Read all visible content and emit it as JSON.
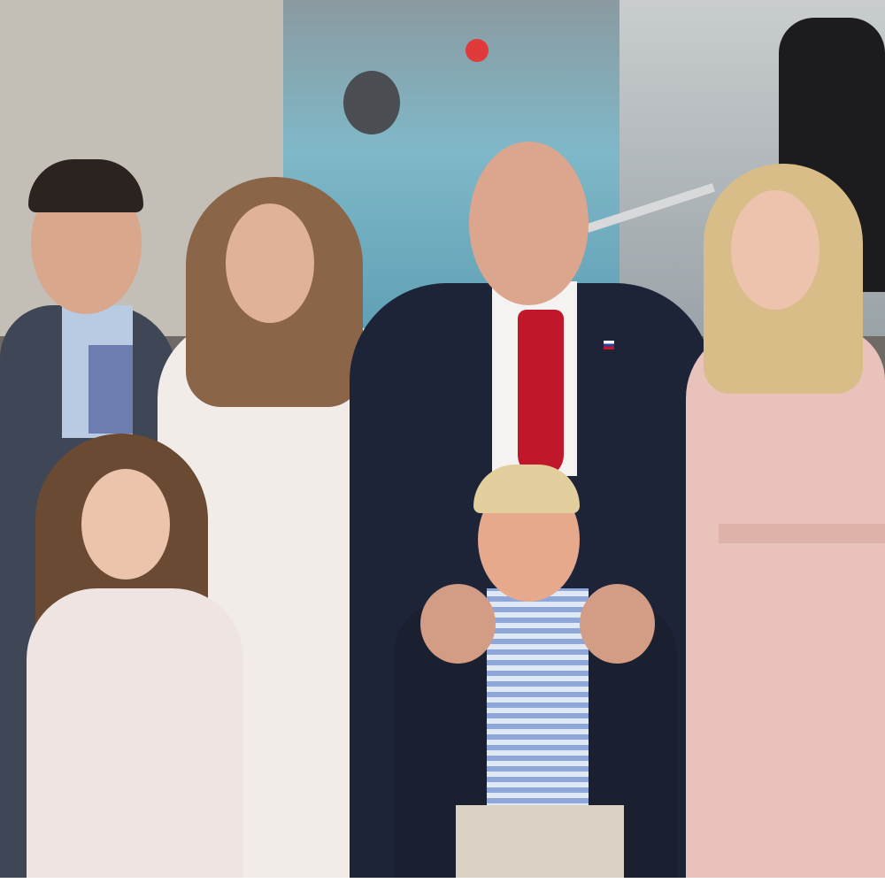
{
  "colors": {
    "wall": "#bdb7ae",
    "window": "#7fb6c4",
    "dark_suit": "#1d2438",
    "gray_suit": "#3f4656",
    "white_coat": "#f1ece8",
    "pink_coat": "#e8c2bb",
    "red_tie": "#c0182a",
    "skin": "#e2b49a",
    "blonde_hair": "#d9bd88",
    "brown_hair": "#6b4a34",
    "dark_hair": "#2b231f",
    "gingham_shirt": "#8ea6d8",
    "khaki": "#d9d2c4"
  }
}
